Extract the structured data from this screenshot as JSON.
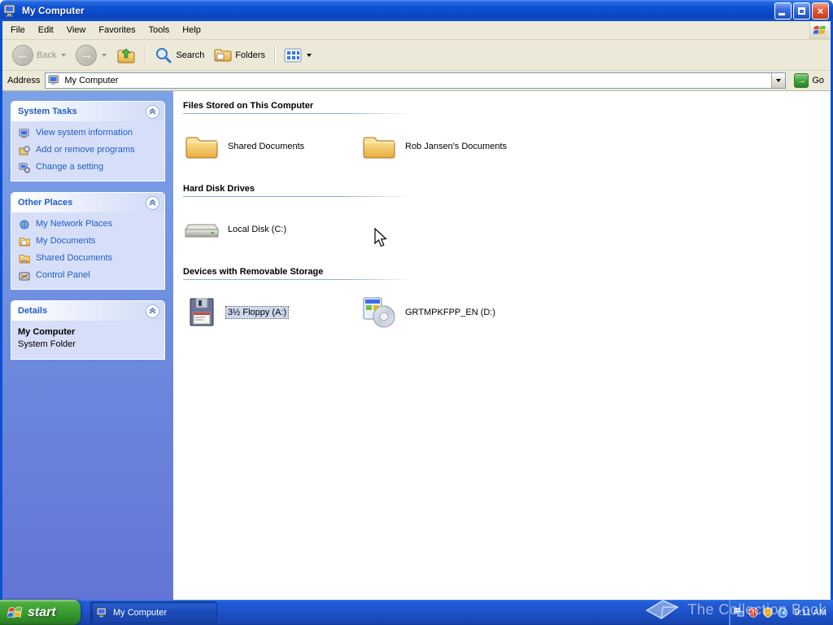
{
  "window": {
    "title": "My Computer"
  },
  "menu": {
    "items": [
      "File",
      "Edit",
      "View",
      "Favorites",
      "Tools",
      "Help"
    ]
  },
  "toolbar": {
    "back_label": "Back",
    "search_label": "Search",
    "folders_label": "Folders"
  },
  "address": {
    "label": "Address",
    "value": "My Computer",
    "go_label": "Go"
  },
  "sidebar": {
    "system_tasks": {
      "title": "System Tasks",
      "items": [
        {
          "label": "View system information",
          "icon": "system-info-icon"
        },
        {
          "label": "Add or remove programs",
          "icon": "add-remove-programs-icon"
        },
        {
          "label": "Change a setting",
          "icon": "change-setting-icon"
        }
      ]
    },
    "other_places": {
      "title": "Other Places",
      "items": [
        {
          "label": "My Network Places",
          "icon": "network-places-icon"
        },
        {
          "label": "My Documents",
          "icon": "my-documents-icon"
        },
        {
          "label": "Shared Documents",
          "icon": "shared-documents-icon"
        },
        {
          "label": "Control Panel",
          "icon": "control-panel-icon"
        }
      ]
    },
    "details": {
      "title": "Details",
      "name": "My Computer",
      "description": "System Folder"
    }
  },
  "content": {
    "sections": [
      {
        "title": "Files Stored on This Computer",
        "items": [
          {
            "label": "Shared Documents",
            "icon": "folder-icon"
          },
          {
            "label": "Rob Jansen's Documents",
            "icon": "folder-icon"
          }
        ]
      },
      {
        "title": "Hard Disk Drives",
        "items": [
          {
            "label": "Local Disk (C:)",
            "icon": "hard-disk-icon"
          }
        ]
      },
      {
        "title": "Devices with Removable Storage",
        "items": [
          {
            "label": "3½ Floppy (A:)",
            "icon": "floppy-icon",
            "selected": true
          },
          {
            "label": "GRTMPKFPP_EN (D:)",
            "icon": "cd-drive-icon"
          }
        ]
      }
    ]
  },
  "taskbar": {
    "start_label": "start",
    "task_label": "My Computer",
    "clock": "9:11 AM"
  },
  "watermark": {
    "text": "The Collection Book"
  },
  "colors": {
    "titlebar_blue": "#0e52d6",
    "taskbar_blue": "#245edb",
    "start_green": "#379a2e",
    "link_blue": "#215dc6",
    "taskpane_bg": "#d6dff7"
  }
}
